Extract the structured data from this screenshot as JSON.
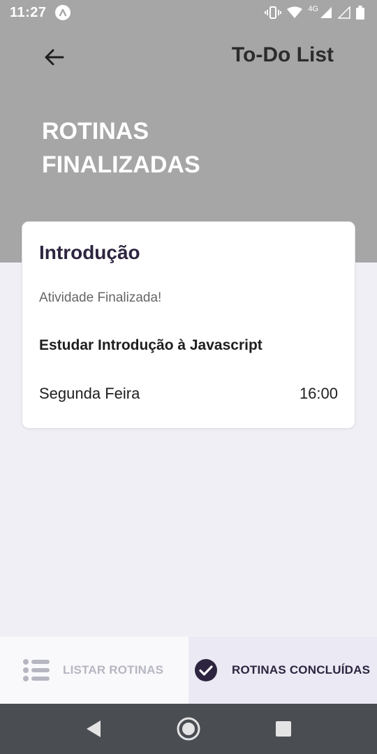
{
  "status_bar": {
    "time": "11:27",
    "network": "4G"
  },
  "header": {
    "app_title": "To-Do List",
    "page_title": "ROTINAS FINALIZADAS"
  },
  "card": {
    "title": "Introdução",
    "status": "Atividade Finalizada!",
    "task": "Estudar Introdução à Javascript",
    "day": "Segunda Feira",
    "time": "16:00"
  },
  "tabs": [
    {
      "label": "LISTAR ROTINAS",
      "icon": "list-icon",
      "active": false
    },
    {
      "label": "ROTINAS CONCLUÍDAS",
      "icon": "check-circle-icon",
      "active": true
    }
  ],
  "colors": {
    "header_bg": "#a6a6a6",
    "accent": "#2d2540",
    "page_bg": "#f0eff5"
  }
}
